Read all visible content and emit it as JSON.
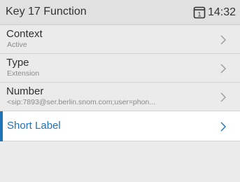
{
  "header": {
    "title": "Key 17 Function",
    "line_badge": "1",
    "line_icon": "line-status-icon",
    "time": "14:32"
  },
  "items": [
    {
      "label": "Context",
      "value": "Active",
      "icon": "chevron-right-icon"
    },
    {
      "label": "Type",
      "value": "Extension",
      "icon": "chevron-right-icon"
    },
    {
      "label": "Number",
      "value": "<sip:7893@ser.berlin.snom.com;user=phon...",
      "icon": "chevron-right-icon"
    },
    {
      "label": "Short Label",
      "value": "",
      "icon": "chevron-right-icon",
      "selected": true
    }
  ],
  "colors": {
    "accent": "#1f73b7",
    "background": "#ebebeb",
    "header_bg": "#e1e1e1"
  }
}
